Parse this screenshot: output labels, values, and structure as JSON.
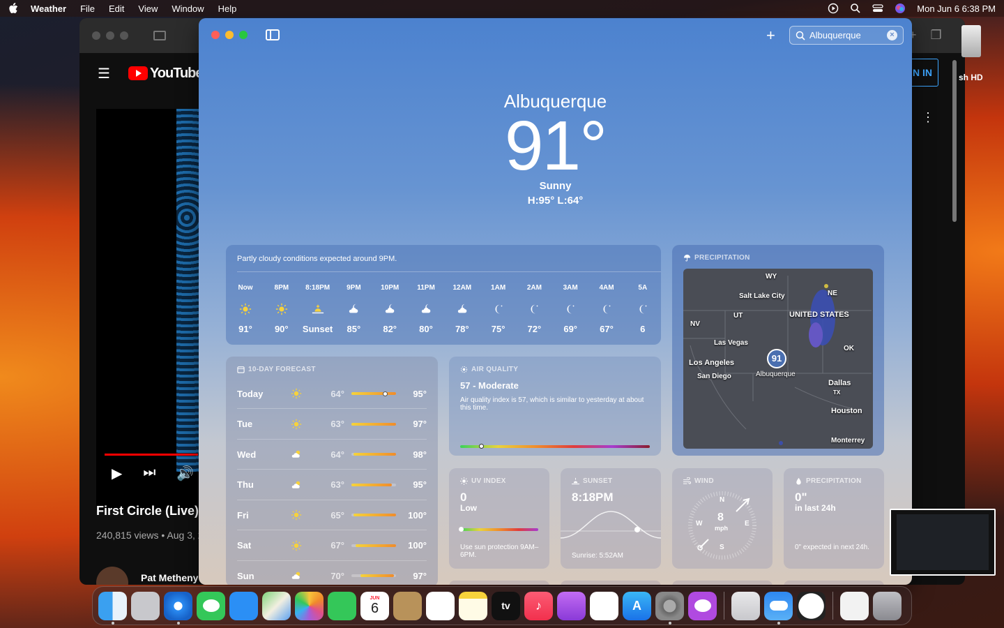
{
  "menubar": {
    "app": "Weather",
    "menus": [
      "File",
      "Edit",
      "View",
      "Window",
      "Help"
    ],
    "datetime": "Mon Jun 6  6:38 PM"
  },
  "youtube": {
    "logo_text": "YouTube",
    "video_title": "First Circle (Live)",
    "views": "240,815 views • Aug 3, 2",
    "channel": "Pat Metheny",
    "signin": "N IN"
  },
  "desktop": {
    "drive_label": "sh HD"
  },
  "weather": {
    "search_value": "Albuquerque",
    "city": "Albuquerque",
    "temp": "91°",
    "condition": "Sunny",
    "hilo": "H:95°  L:64°",
    "hourly_summary": "Partly cloudy conditions expected around 9PM.",
    "hours": [
      {
        "label": "Now",
        "icon": "sun-icon",
        "temp": "91°"
      },
      {
        "label": "8PM",
        "icon": "sun-icon",
        "temp": "90°"
      },
      {
        "label": "8:18PM",
        "icon": "sunset-icon",
        "temp": "Sunset"
      },
      {
        "label": "9PM",
        "icon": "cloud-moon-icon",
        "temp": "85°"
      },
      {
        "label": "10PM",
        "icon": "cloud-moon-icon",
        "temp": "82°"
      },
      {
        "label": "11PM",
        "icon": "cloud-moon-icon",
        "temp": "80°"
      },
      {
        "label": "12AM",
        "icon": "cloud-moon-icon",
        "temp": "78°"
      },
      {
        "label": "1AM",
        "icon": "moon-icon",
        "temp": "75°"
      },
      {
        "label": "2AM",
        "icon": "moon-icon",
        "temp": "72°"
      },
      {
        "label": "3AM",
        "icon": "moon-icon",
        "temp": "69°"
      },
      {
        "label": "4AM",
        "icon": "moon-icon",
        "temp": "67°"
      },
      {
        "label": "5A",
        "icon": "moon-icon",
        "temp": "6"
      }
    ],
    "precip_map": {
      "header": "PRECIPITATION",
      "pin_temp": "91",
      "labels": [
        "WY",
        "Salt Lake City",
        "NE",
        "UT",
        "UNITED STATES",
        "NV",
        "Las Vegas",
        "OK",
        "Los Angeles",
        "San Diego",
        "Albuquerque",
        "Dallas",
        "TX",
        "Houston",
        "Monterrey"
      ]
    },
    "tenday": {
      "header": "10-DAY FORECAST",
      "days": [
        {
          "name": "Today",
          "icon": "sun-icon",
          "lo": "64°",
          "hi": "95°",
          "range_start": 0.0,
          "range_end": 1.0,
          "current": 0.75
        },
        {
          "name": "Tue",
          "icon": "sun-icon",
          "lo": "63°",
          "hi": "97°",
          "range_start": 0.0,
          "range_end": 1.0
        },
        {
          "name": "Wed",
          "icon": "sun-cloud-icon",
          "lo": "64°",
          "hi": "98°",
          "range_start": 0.05,
          "range_end": 1.0
        },
        {
          "name": "Thu",
          "icon": "sun-cloud-icon",
          "lo": "63°",
          "hi": "95°",
          "range_start": 0.0,
          "range_end": 0.9
        },
        {
          "name": "Fri",
          "icon": "sun-icon",
          "lo": "65°",
          "hi": "100°",
          "range_start": 0.05,
          "range_end": 1.0
        },
        {
          "name": "Sat",
          "icon": "sun-icon",
          "lo": "67°",
          "hi": "100°",
          "range_start": 0.1,
          "range_end": 1.0
        },
        {
          "name": "Sun",
          "icon": "sun-cloud-icon",
          "lo": "70°",
          "hi": "97°",
          "range_start": 0.2,
          "range_end": 0.95
        }
      ]
    },
    "air_quality": {
      "header": "AIR QUALITY",
      "value": "57 - Moderate",
      "description": "Air quality index is 57, which is similar to yesterday at about this time.",
      "level": 0.11
    },
    "uv": {
      "header": "UV INDEX",
      "value": "0",
      "label": "Low",
      "foot": "Use sun protection 9AM–6PM."
    },
    "sunset": {
      "header": "SUNSET",
      "time": "8:18PM",
      "sunrise": "Sunrise: 5:52AM"
    },
    "wind": {
      "header": "WIND",
      "speed": "8",
      "unit": "mph",
      "n": "N",
      "e": "E",
      "s": "S",
      "w": "W"
    },
    "precip": {
      "header": "PRECIPITATION",
      "value": "0\"",
      "sub": "in last 24h",
      "foot": "0\" expected in next 24h."
    }
  },
  "dock": [
    "finder",
    "launchpad",
    "safari",
    "messages",
    "mail",
    "maps",
    "photos",
    "facetime",
    "calendar",
    "contacts",
    "reminders",
    "notes",
    "tv",
    "music",
    "podcasts",
    "news",
    "app-store",
    "system-settings",
    "feedback",
    "preview",
    "weather",
    "clock",
    "document",
    "trash"
  ],
  "dock_calendar": {
    "month": "JUN",
    "day": "6"
  },
  "dock_tv_label": "tv"
}
